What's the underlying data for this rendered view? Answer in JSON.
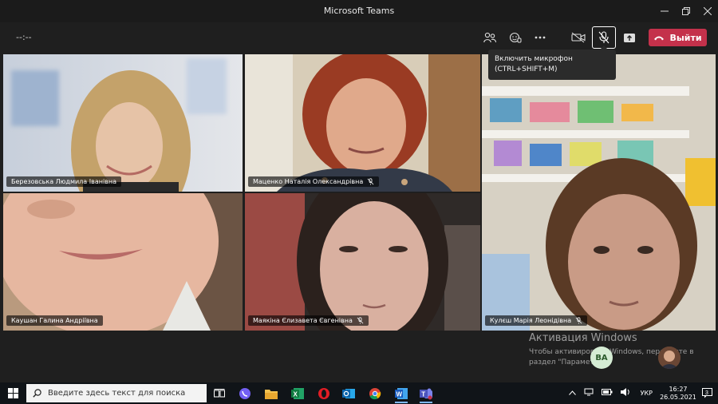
{
  "window": {
    "title": "Microsoft Teams"
  },
  "meeting": {
    "timer": "--:--",
    "leave_label": "Выйти",
    "tooltip_line1": "Включить микрофон",
    "tooltip_line2": "(CTRL+SHIFT+M)"
  },
  "participants": [
    {
      "name": "Березовська Людмила Іванівна",
      "muted": false
    },
    {
      "name": "Маценко Наталія Олександрівна",
      "muted": true
    },
    {
      "name": "",
      "muted": false
    },
    {
      "name": "Каушан Галина Андріївна",
      "muted": false
    },
    {
      "name": "Маякіна Єлизавета Євгенівна",
      "muted": true
    },
    {
      "name": "Кулєш Марія Леонідівна",
      "muted": true
    }
  ],
  "activation": {
    "title": "Активация Windows",
    "line1": "Чтобы активировать Windows, перейдите в",
    "line2": "раздел \"Параметры\"."
  },
  "self_avatar_initials": "ВА",
  "taskbar": {
    "search_placeholder": "Введите здесь текст для поиска",
    "language": "УКР",
    "time": "16:27",
    "date": "26.05.2021",
    "notification_count": "3"
  },
  "colors": {
    "accent_leave": "#c4314b",
    "taskbar": "#101418"
  }
}
